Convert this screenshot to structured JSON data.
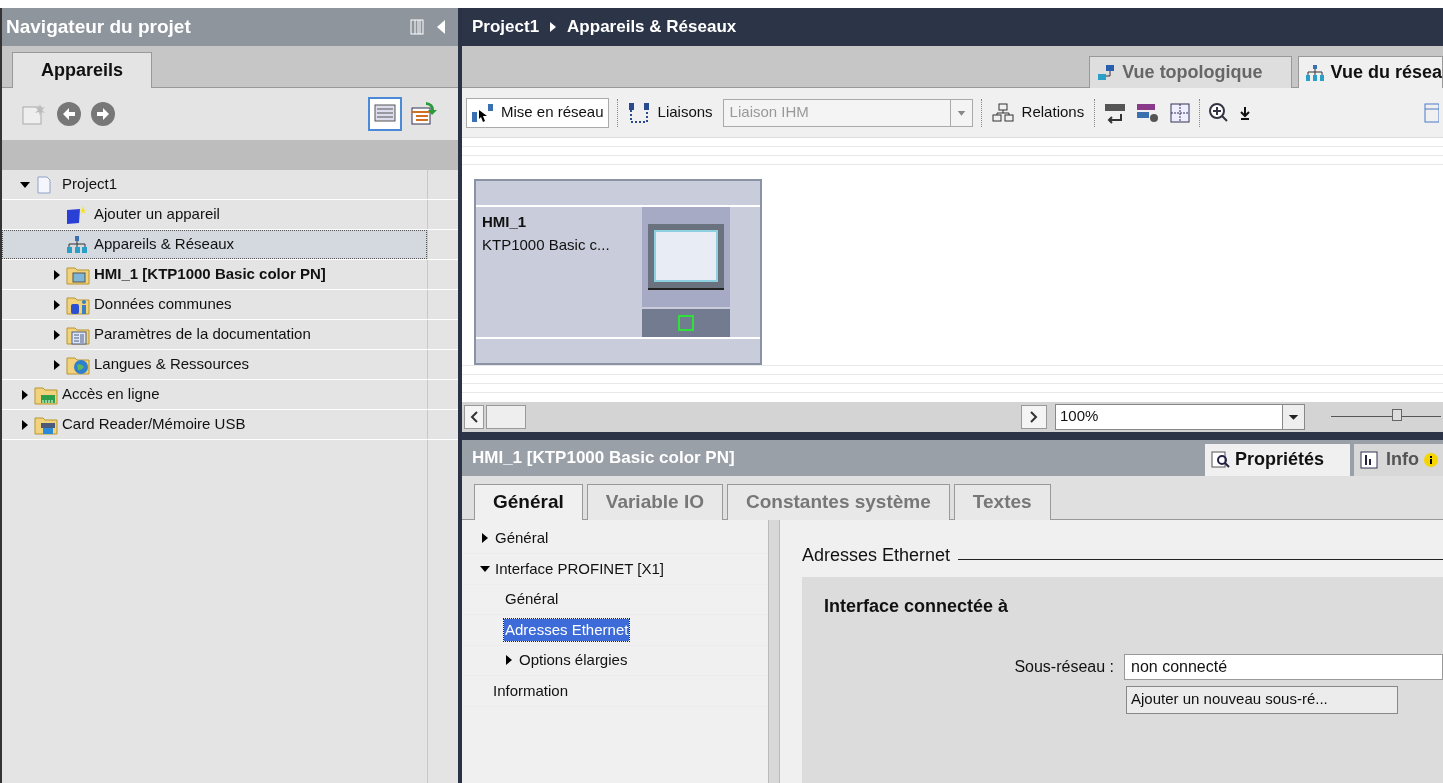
{
  "navigator": {
    "title": "Navigateur du projet",
    "tabs": [
      {
        "label": "Appareils",
        "selected": true
      }
    ],
    "tree": [
      {
        "label": "Project1",
        "kind": "branch",
        "expanded": true,
        "selected": false,
        "bold": false,
        "children": [
          {
            "label": "Ajouter un appareil",
            "kind": "leaf",
            "selected": false,
            "bold": false
          },
          {
            "label": "Appareils & Réseaux",
            "kind": "leaf",
            "selected": true,
            "bold": false
          },
          {
            "label": "HMI_1 [KTP1000 Basic color PN]",
            "kind": "branch",
            "expanded": false,
            "selected": false,
            "bold": true
          },
          {
            "label": "Données communes",
            "kind": "branch",
            "expanded": false,
            "selected": false,
            "bold": false
          },
          {
            "label": "Paramètres de la documentation",
            "kind": "branch",
            "expanded": false,
            "selected": false,
            "bold": false
          },
          {
            "label": "Langues & Ressources",
            "kind": "branch",
            "expanded": false,
            "selected": false,
            "bold": false
          }
        ]
      },
      {
        "label": "Accès en ligne",
        "kind": "branch",
        "expanded": false,
        "selected": false,
        "bold": false
      },
      {
        "label": "Card Reader/Mémoire USB",
        "kind": "branch",
        "expanded": false,
        "selected": false,
        "bold": false
      }
    ]
  },
  "editor": {
    "breadcrumb": [
      "Project1",
      "Appareils & Réseaux"
    ],
    "view_tabs": [
      {
        "label": "Vue topologique",
        "selected": false
      },
      {
        "label": "Vue du résea",
        "selected": true
      }
    ],
    "toolbar": {
      "networking": {
        "label": "Mise en réseau",
        "selected": true
      },
      "connections": "Liaisons",
      "connection_type": {
        "value": "Liaison IHM",
        "disabled": true
      },
      "relations": "Relations"
    },
    "device": {
      "name": "HMI_1",
      "type": "KTP1000 Basic c..."
    },
    "zoom": {
      "value": "100%",
      "level": 0.6
    }
  },
  "inspector": {
    "title": "HMI_1 [KTP1000 Basic color PN]",
    "tabs": [
      {
        "label": "Propriétés",
        "selected": true
      },
      {
        "label": "Info",
        "selected": false
      }
    ],
    "sub_tabs": [
      {
        "label": "Général",
        "selected": true
      },
      {
        "label": "Variable IO",
        "selected": false
      },
      {
        "label": "Constantes système",
        "selected": false
      },
      {
        "label": "Textes",
        "selected": false
      }
    ],
    "nav": [
      {
        "label": "Général",
        "kind": "branch",
        "expanded": false,
        "selected": false
      },
      {
        "label": "Interface PROFINET [X1]",
        "kind": "branch",
        "expanded": true,
        "selected": false,
        "children": [
          {
            "label": "Général",
            "kind": "leaf",
            "selected": false
          },
          {
            "label": "Adresses Ethernet",
            "kind": "leaf",
            "selected": true
          },
          {
            "label": "Options élargies",
            "kind": "branch",
            "expanded": false,
            "selected": false
          }
        ]
      },
      {
        "label": "Information",
        "kind": "leaf",
        "selected": false
      }
    ],
    "section": "Adresses Ethernet",
    "group": "Interface connectée à",
    "subnet": {
      "label": "Sous-réseau :",
      "value": "non connecté"
    },
    "add_button": "Ajouter un nouveau sous-ré..."
  }
}
